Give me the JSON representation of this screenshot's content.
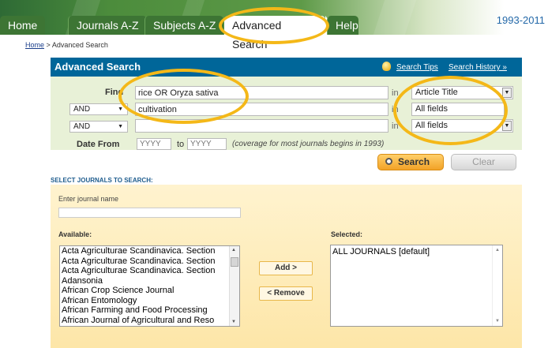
{
  "nav": {
    "tabs": [
      {
        "label": "Home"
      },
      {
        "label": "Journals A-Z"
      },
      {
        "label": "Subjects A-Z"
      },
      {
        "label": "Advanced Search"
      },
      {
        "label": "Help"
      }
    ],
    "year_range": "1993-2011"
  },
  "breadcrumb": {
    "home": "Home",
    "separator": ">",
    "current": "Advanced Search"
  },
  "panel": {
    "title": "Advanced Search",
    "search_tips": "Search Tips",
    "search_history": "Search History »"
  },
  "criteria": {
    "find_label": "Find",
    "in_label": "in",
    "rows": [
      {
        "operator": "",
        "term": "rice OR Oryza sativa",
        "field": "Article Title"
      },
      {
        "operator": "AND",
        "term": "cultivation",
        "field": "All fields"
      },
      {
        "operator": "AND",
        "term": "",
        "field": "All fields"
      }
    ],
    "date_from_label": "Date From",
    "date_from_placeholder": "YYYY",
    "to_label": "to",
    "date_to_placeholder": "YYYY",
    "coverage_note": "(coverage for most journals begins in 1993)"
  },
  "buttons": {
    "search": "Search",
    "clear": "Clear",
    "add": "Add >",
    "remove": "< Remove"
  },
  "journals": {
    "section_title": "SELECT JOURNALS TO SEARCH:",
    "enter_label": "Enter journal name",
    "available_label": "Available:",
    "selected_label": "Selected:",
    "available": [
      "Acta Agriculturae Scandinavica. Section",
      "Acta Agriculturae Scandinavica. Section",
      "Acta Agriculturae Scandinavica. Section",
      "Adansonia",
      "African Crop Science Journal",
      "African Entomology",
      "African Farming and Food Processing",
      "African Journal of Agricultural and Reso"
    ],
    "selected": [
      "ALL JOURNALS [default]"
    ]
  },
  "colors": {
    "panel_header": "#006699",
    "criteria_bg": "#e8f1d7",
    "highlight_ring": "#f4b818",
    "nav_green": "#3d7534"
  }
}
